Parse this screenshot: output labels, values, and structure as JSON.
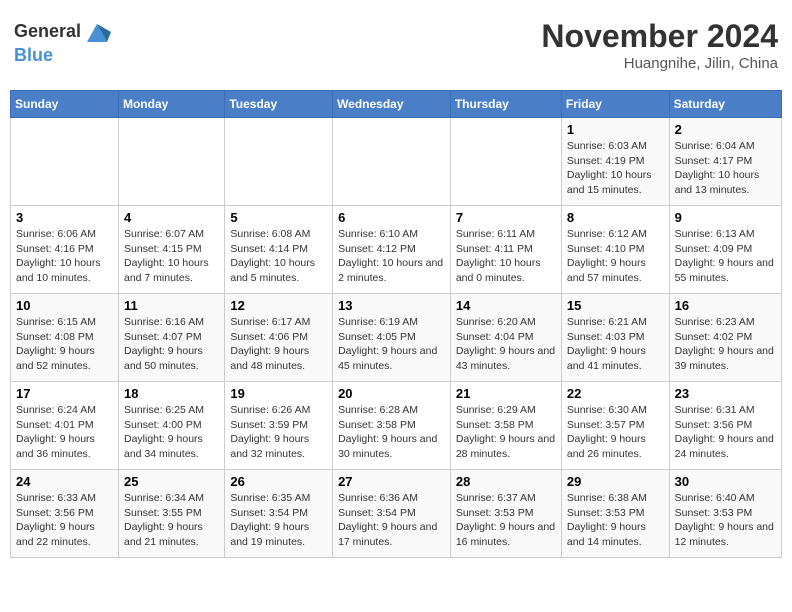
{
  "header": {
    "logo_general": "General",
    "logo_blue": "Blue",
    "month_title": "November 2024",
    "location": "Huangnihe, Jilin, China"
  },
  "days_of_week": [
    "Sunday",
    "Monday",
    "Tuesday",
    "Wednesday",
    "Thursday",
    "Friday",
    "Saturday"
  ],
  "weeks": [
    [
      {
        "day": "",
        "info": ""
      },
      {
        "day": "",
        "info": ""
      },
      {
        "day": "",
        "info": ""
      },
      {
        "day": "",
        "info": ""
      },
      {
        "day": "",
        "info": ""
      },
      {
        "day": "1",
        "info": "Sunrise: 6:03 AM\nSunset: 4:19 PM\nDaylight: 10 hours and 15 minutes."
      },
      {
        "day": "2",
        "info": "Sunrise: 6:04 AM\nSunset: 4:17 PM\nDaylight: 10 hours and 13 minutes."
      }
    ],
    [
      {
        "day": "3",
        "info": "Sunrise: 6:06 AM\nSunset: 4:16 PM\nDaylight: 10 hours and 10 minutes."
      },
      {
        "day": "4",
        "info": "Sunrise: 6:07 AM\nSunset: 4:15 PM\nDaylight: 10 hours and 7 minutes."
      },
      {
        "day": "5",
        "info": "Sunrise: 6:08 AM\nSunset: 4:14 PM\nDaylight: 10 hours and 5 minutes."
      },
      {
        "day": "6",
        "info": "Sunrise: 6:10 AM\nSunset: 4:12 PM\nDaylight: 10 hours and 2 minutes."
      },
      {
        "day": "7",
        "info": "Sunrise: 6:11 AM\nSunset: 4:11 PM\nDaylight: 10 hours and 0 minutes."
      },
      {
        "day": "8",
        "info": "Sunrise: 6:12 AM\nSunset: 4:10 PM\nDaylight: 9 hours and 57 minutes."
      },
      {
        "day": "9",
        "info": "Sunrise: 6:13 AM\nSunset: 4:09 PM\nDaylight: 9 hours and 55 minutes."
      }
    ],
    [
      {
        "day": "10",
        "info": "Sunrise: 6:15 AM\nSunset: 4:08 PM\nDaylight: 9 hours and 52 minutes."
      },
      {
        "day": "11",
        "info": "Sunrise: 6:16 AM\nSunset: 4:07 PM\nDaylight: 9 hours and 50 minutes."
      },
      {
        "day": "12",
        "info": "Sunrise: 6:17 AM\nSunset: 4:06 PM\nDaylight: 9 hours and 48 minutes."
      },
      {
        "day": "13",
        "info": "Sunrise: 6:19 AM\nSunset: 4:05 PM\nDaylight: 9 hours and 45 minutes."
      },
      {
        "day": "14",
        "info": "Sunrise: 6:20 AM\nSunset: 4:04 PM\nDaylight: 9 hours and 43 minutes."
      },
      {
        "day": "15",
        "info": "Sunrise: 6:21 AM\nSunset: 4:03 PM\nDaylight: 9 hours and 41 minutes."
      },
      {
        "day": "16",
        "info": "Sunrise: 6:23 AM\nSunset: 4:02 PM\nDaylight: 9 hours and 39 minutes."
      }
    ],
    [
      {
        "day": "17",
        "info": "Sunrise: 6:24 AM\nSunset: 4:01 PM\nDaylight: 9 hours and 36 minutes."
      },
      {
        "day": "18",
        "info": "Sunrise: 6:25 AM\nSunset: 4:00 PM\nDaylight: 9 hours and 34 minutes."
      },
      {
        "day": "19",
        "info": "Sunrise: 6:26 AM\nSunset: 3:59 PM\nDaylight: 9 hours and 32 minutes."
      },
      {
        "day": "20",
        "info": "Sunrise: 6:28 AM\nSunset: 3:58 PM\nDaylight: 9 hours and 30 minutes."
      },
      {
        "day": "21",
        "info": "Sunrise: 6:29 AM\nSunset: 3:58 PM\nDaylight: 9 hours and 28 minutes."
      },
      {
        "day": "22",
        "info": "Sunrise: 6:30 AM\nSunset: 3:57 PM\nDaylight: 9 hours and 26 minutes."
      },
      {
        "day": "23",
        "info": "Sunrise: 6:31 AM\nSunset: 3:56 PM\nDaylight: 9 hours and 24 minutes."
      }
    ],
    [
      {
        "day": "24",
        "info": "Sunrise: 6:33 AM\nSunset: 3:56 PM\nDaylight: 9 hours and 22 minutes."
      },
      {
        "day": "25",
        "info": "Sunrise: 6:34 AM\nSunset: 3:55 PM\nDaylight: 9 hours and 21 minutes."
      },
      {
        "day": "26",
        "info": "Sunrise: 6:35 AM\nSunset: 3:54 PM\nDaylight: 9 hours and 19 minutes."
      },
      {
        "day": "27",
        "info": "Sunrise: 6:36 AM\nSunset: 3:54 PM\nDaylight: 9 hours and 17 minutes."
      },
      {
        "day": "28",
        "info": "Sunrise: 6:37 AM\nSunset: 3:53 PM\nDaylight: 9 hours and 16 minutes."
      },
      {
        "day": "29",
        "info": "Sunrise: 6:38 AM\nSunset: 3:53 PM\nDaylight: 9 hours and 14 minutes."
      },
      {
        "day": "30",
        "info": "Sunrise: 6:40 AM\nSunset: 3:53 PM\nDaylight: 9 hours and 12 minutes."
      }
    ]
  ]
}
